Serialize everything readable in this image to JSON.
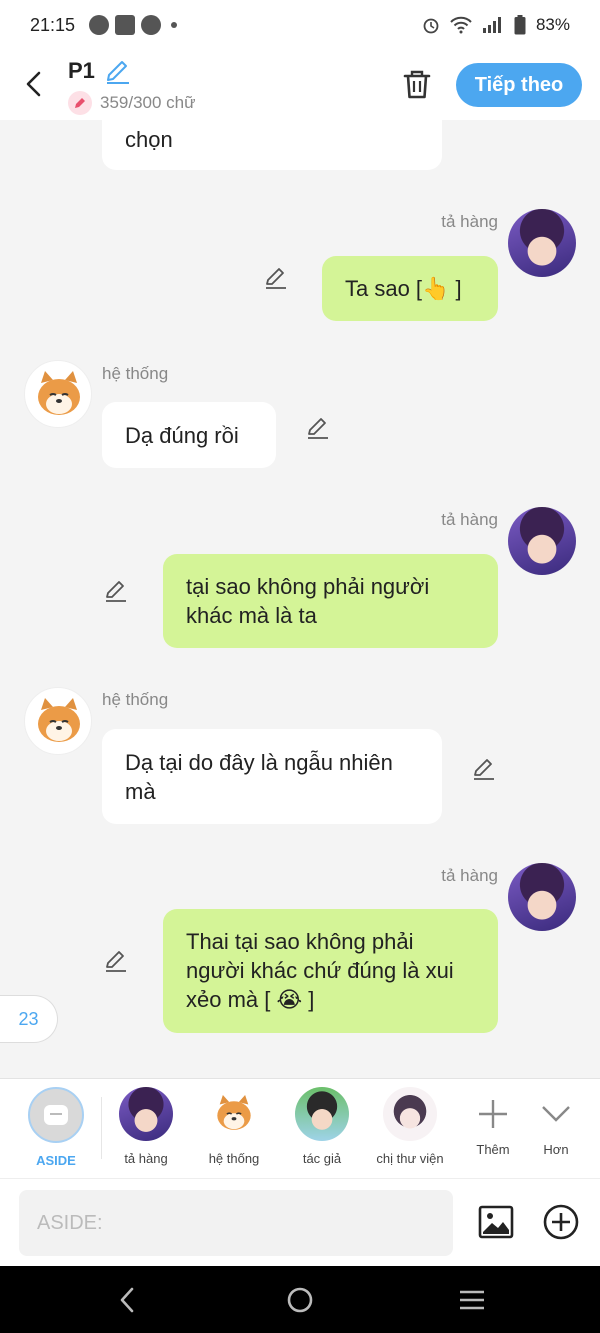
{
  "status_bar": {
    "time": "21:15",
    "battery": "83%"
  },
  "header": {
    "title": "P1",
    "word_count": "359/300 chữ",
    "next_label": "Tiếp theo"
  },
  "messages": [
    {
      "text": "chọn"
    },
    {
      "sender": "tả hàng",
      "text": "Ta sao [👆 ]"
    },
    {
      "sender": "hệ thống",
      "text": "Dạ đúng rồi"
    },
    {
      "sender": "tả hàng",
      "text": "tại sao không phải người khác mà là ta"
    },
    {
      "sender": "hệ thống",
      "text": "Dạ tại do đây là ngẫu nhiên mà"
    },
    {
      "sender": "tả hàng",
      "text": "Thai tại sao không phải người khác chứ đúng là xui xẻo mà [ 😭 ]"
    }
  ],
  "float_badge": "23",
  "characters": [
    {
      "label": "ASIDE"
    },
    {
      "label": "tả hàng"
    },
    {
      "label": "hệ thống"
    },
    {
      "label": "tác giả"
    },
    {
      "label": "chị thư viện"
    },
    {
      "label": "Thêm"
    },
    {
      "label": "Hơn"
    }
  ],
  "input": {
    "placeholder": "ASIDE:"
  },
  "colors": {
    "accent": "#4ca7f0",
    "right_bubble": "#d4f497",
    "left_bubble": "#ffffff"
  },
  "icons": [
    "back-arrow-icon",
    "pencil-icon",
    "trash-icon",
    "image-icon",
    "add-circle-icon",
    "plus-icon",
    "chevron-down-icon",
    "nav-back-icon",
    "nav-home-icon",
    "nav-menu-icon"
  ]
}
